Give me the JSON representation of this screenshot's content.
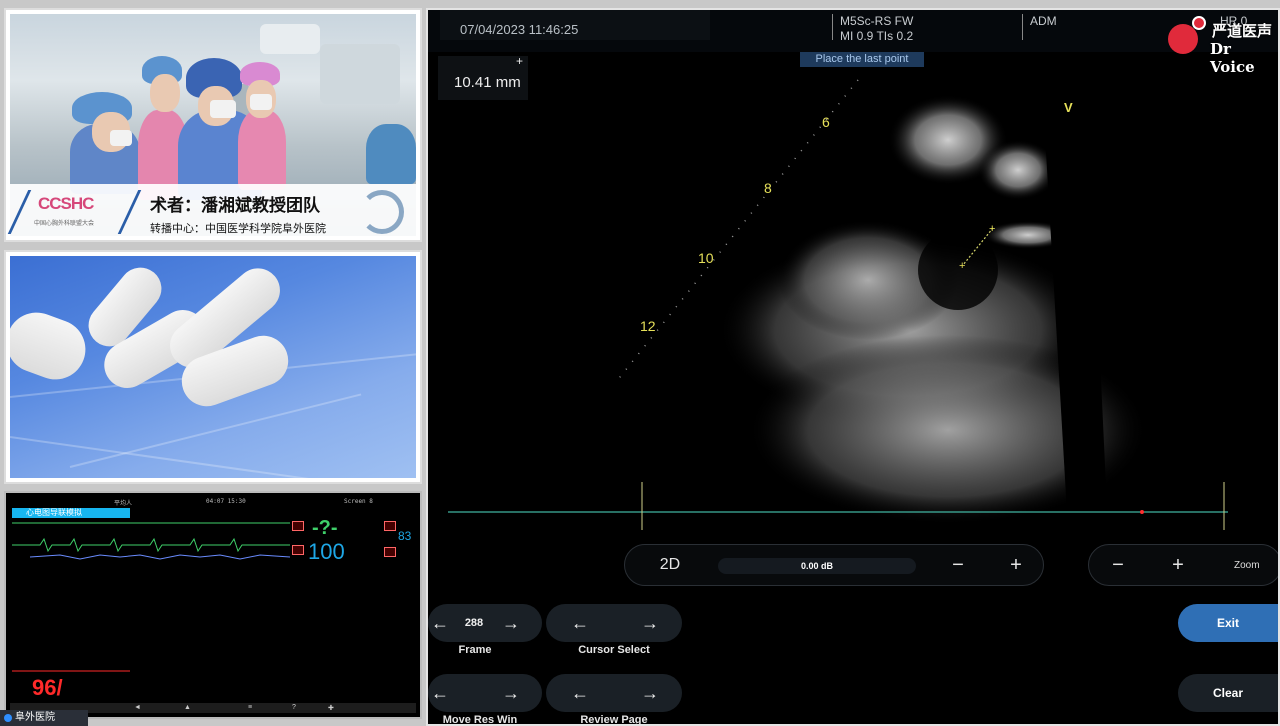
{
  "left": {
    "caption": {
      "logo": "CCSHC",
      "logo_sub": "中国心胸外科联盟大会",
      "title": "术者：潘湘斌教授团队",
      "subtitle": "转播中心：中国医学科学院阜外医院"
    },
    "monitor": {
      "ward": "心电图导联模拟",
      "hr_value": "-?-",
      "spo2_value": "100",
      "pulse_value": "83",
      "abp_value": "96/",
      "top_items": [
        "平均人",
        "04:07  15:30",
        "Screen 8"
      ],
      "bottom_items": [
        "◄",
        "▲",
        "≡",
        "?",
        "✚"
      ]
    },
    "taskbar_label": "阜外医院"
  },
  "echo": {
    "date": "07/04/2023 11:46:25",
    "probe_line1": "M5Sc-RS  FW",
    "probe_line2": "MI 0.9   TIs 0.2",
    "adm": "ADM",
    "hr": "HR 0",
    "hint": "Place the last point",
    "measurement": "10.41 mm",
    "depth_marks": [
      "6",
      "8",
      "10",
      "12"
    ],
    "v_marker": "V",
    "brand_cn": "严道医声",
    "brand_en": "Dr Voice",
    "mode": "2D",
    "gain": "0.00 dB",
    "zoom_label": "Zoom",
    "frame_value": "288",
    "frame_label": "Frame",
    "cursor_label": "Cursor Select",
    "move_label": "Move Res Win",
    "review_label": "Review Page",
    "exit": "Exit",
    "clear": "Clear",
    "minus": "−",
    "plus": "+",
    "arrow_left": "←",
    "arrow_right": "→"
  },
  "colors": {
    "accent": "#2f6fb5",
    "yellow_marks": "#e6e05a",
    "brand_red": "#e02a3b"
  }
}
